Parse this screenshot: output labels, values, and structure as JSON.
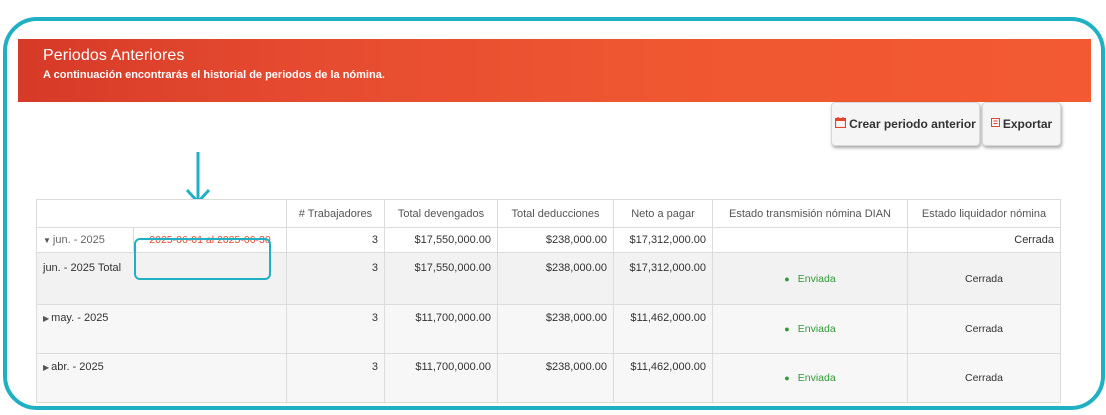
{
  "header": {
    "title": "Periodos Anteriores",
    "subtitle": "A continuación encontrarás el historial de periodos de la nómina."
  },
  "toolbar": {
    "crear_label": "Crear periodo anterior",
    "crear_icon": "calendar-icon",
    "export_label": "Exportar",
    "export_icon": "export-icon"
  },
  "table": {
    "columns": [
      "",
      "# Trabajadores",
      "Total devengados",
      "Total deducciones",
      "Neto a pagar",
      "Estado transmisión nómina DIAN",
      "Estado liquidador nómina"
    ],
    "rows": [
      {
        "period": "jun. - 2025",
        "range": "2025-06-01 al 2025-06-30",
        "workers": "3",
        "devengados": "$17,550,000.00",
        "deducciones": "$238,000.00",
        "neto": "$17,312,000.00",
        "dian": "",
        "liquidador": "Cerrada"
      },
      {
        "period": "jun. - 2025 Total",
        "workers": "3",
        "devengados": "$17,550,000.00",
        "deducciones": "$238,000.00",
        "neto": "$17,312,000.00",
        "dian": "Enviada",
        "liquidador": "Cerrada"
      },
      {
        "period": "may. - 2025",
        "workers": "3",
        "devengados": "$11,700,000.00",
        "deducciones": "$238,000.00",
        "neto": "$11,462,000.00",
        "dian": "Enviada",
        "liquidador": "Cerrada"
      },
      {
        "period": "abr. - 2025",
        "workers": "3",
        "devengados": "$11,700,000.00",
        "deducciones": "$238,000.00",
        "neto": "$11,462,000.00",
        "dian": "Enviada",
        "liquidador": "Cerrada"
      }
    ]
  },
  "colors": {
    "accent": "#1fb1c3",
    "header": "#ef5731",
    "status_green": "#2e9b35",
    "range_red": "#e04a2e"
  }
}
